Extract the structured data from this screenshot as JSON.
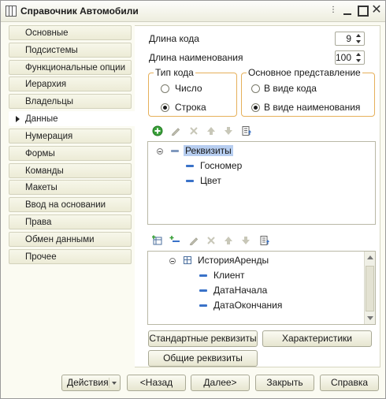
{
  "window": {
    "title": "Справочник Автомобили"
  },
  "sidebar": {
    "items": [
      {
        "label": "Основные"
      },
      {
        "label": "Подсистемы"
      },
      {
        "label": "Функциональные опции"
      },
      {
        "label": "Иерархия"
      },
      {
        "label": "Владельцы"
      },
      {
        "label": "Данные",
        "active": true
      },
      {
        "label": "Нумерация"
      },
      {
        "label": "Формы"
      },
      {
        "label": "Команды"
      },
      {
        "label": "Макеты"
      },
      {
        "label": "Ввод на основании"
      },
      {
        "label": "Права"
      },
      {
        "label": "Обмен данными"
      },
      {
        "label": "Прочее"
      }
    ]
  },
  "main": {
    "code_length_label": "Длина кода",
    "code_length_value": "9",
    "name_length_label": "Длина наименования",
    "name_length_value": "100",
    "code_type": {
      "title": "Тип кода",
      "options": [
        "Число",
        "Строка"
      ],
      "selected": "Строка"
    },
    "main_presentation": {
      "title": "Основное представление",
      "options": [
        "В виде кода",
        "В виде наименования"
      ],
      "selected": "В виде наименования"
    },
    "attributes_tree": {
      "root": "Реквизиты",
      "children": [
        "Госномер",
        "Цвет"
      ]
    },
    "tabular_tree": {
      "root": "ИсторияАренды",
      "children": [
        "Клиент",
        "ДатаНачала",
        "ДатаОкончания"
      ]
    },
    "buttons": {
      "standard_attributes": "Стандартные реквизиты",
      "characteristics": "Характеристики",
      "common_attributes": "Общие реквизиты"
    }
  },
  "footer": {
    "actions": "Действия",
    "back": "<Назад",
    "next": "Далее>",
    "close": "Закрыть",
    "help": "Справка"
  },
  "colors": {
    "accent_green": "#3aa03a",
    "selection": "#b7cef0",
    "group_border": "#e6b05a",
    "attribute_dash": "#3a72c8"
  }
}
